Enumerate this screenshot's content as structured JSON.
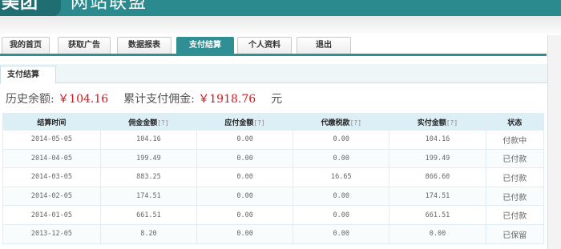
{
  "header": {
    "logo_text": "美团",
    "site_title": "网站联盟"
  },
  "nav": {
    "tabs": [
      {
        "label": "我的首页"
      },
      {
        "label": "获取广告"
      },
      {
        "label": "数据报表"
      },
      {
        "label": "支付结算",
        "active": true
      },
      {
        "label": "个人资料"
      },
      {
        "label": "退出"
      }
    ]
  },
  "subtab": {
    "label": "支付结算"
  },
  "summary": {
    "history_label": "历史余额:",
    "history_value": "￥104.16",
    "total_label": "累计支付佣金:",
    "total_value": "￥1918.76",
    "unit": "元"
  },
  "table": {
    "headers": [
      {
        "label": "结算时间",
        "hint": ""
      },
      {
        "label": "佣金金额",
        "hint": "[?]"
      },
      {
        "label": "应付金额",
        "hint": "[?]"
      },
      {
        "label": "代缴税款",
        "hint": "[?]"
      },
      {
        "label": "实付金额",
        "hint": "[?]"
      },
      {
        "label": "状态",
        "hint": ""
      }
    ],
    "rows": [
      [
        "2014-05-05",
        "104.16",
        "0.00",
        "0.00",
        "104.16",
        "付款中"
      ],
      [
        "2014-04-05",
        "199.49",
        "0.00",
        "0.00",
        "199.49",
        "已付款"
      ],
      [
        "2014-03-05",
        "883.25",
        "0.00",
        "16.65",
        "866.60",
        "已付款"
      ],
      [
        "2014-02-05",
        "174.51",
        "0.00",
        "0.00",
        "174.51",
        "已付款"
      ],
      [
        "2014-01-05",
        "661.51",
        "0.00",
        "0.00",
        "661.51",
        "已付款"
      ],
      [
        "2013-12-05",
        "8.20",
        "0.00",
        "0.00",
        "0.00",
        "已保留"
      ]
    ]
  },
  "colors": {
    "brand": "#2a8a8e",
    "money_red": "#d9141c",
    "header_row": "#dceef6"
  }
}
